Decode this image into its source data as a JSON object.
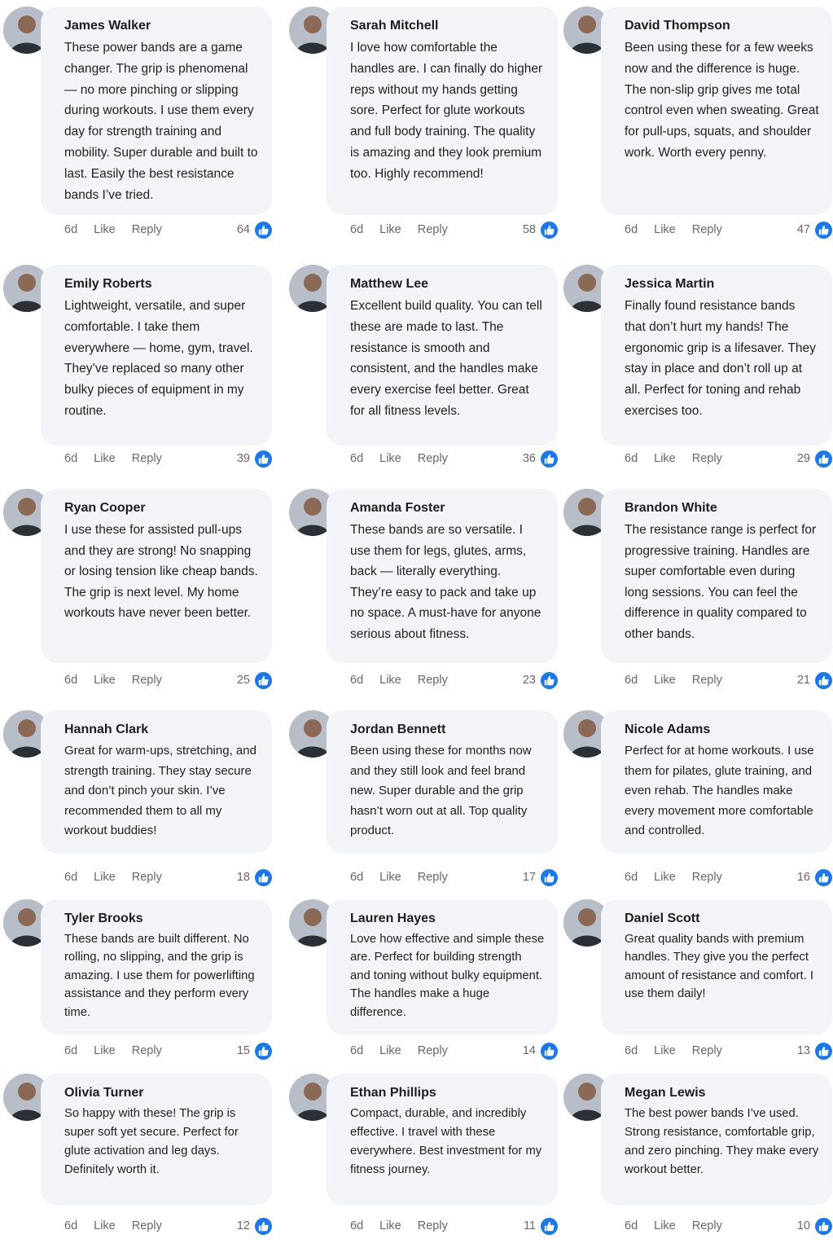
{
  "comments": [
    {
      "name": "James Walker",
      "text": "These power bands are a game changer. The grip is phenomenal — no more pinching or slipping during workouts. I use them every day for strength training and mobility. Super durable and built to last. Easily the best resistance bands I’ve tried.",
      "time": "6d",
      "like": "Like",
      "reply": "Reply",
      "count": "64"
    },
    {
      "name": "Sarah Mitchell",
      "text": "I love how comfortable the handles are. I can finally do higher reps without my hands getting sore. Perfect for glute workouts and full body training. The quality is amazing and they look premium too. Highly recommend!",
      "time": "6d",
      "like": "Like",
      "reply": "Reply",
      "count": "58"
    },
    {
      "name": "David Thompson",
      "text": "Been using these for a few weeks now and the difference is huge. The non-slip grip gives me total control even when sweating. Great for pull-ups, squats, and shoulder work. Worth every penny.",
      "time": "6d",
      "like": "Like",
      "reply": "Reply",
      "count": "47"
    },
    {
      "name": "Emily Roberts",
      "text": "Lightweight, versatile, and super comfortable. I take them everywhere — home, gym, travel. They’ve replaced so many other bulky pieces of equipment in my routine.",
      "time": "6d",
      "like": "Like",
      "reply": "Reply",
      "count": "39"
    },
    {
      "name": "Matthew Lee",
      "text": "Excellent build quality. You can tell these are made to last. The resistance is smooth and consistent, and the handles make every exercise feel better. Great for all fitness levels.",
      "time": "6d",
      "like": "Like",
      "reply": "Reply",
      "count": "36"
    },
    {
      "name": "Jessica Martin",
      "text": "Finally found resistance bands that don’t hurt my hands! The ergonomic grip is a lifesaver. They stay in place and don’t roll up at all. Perfect for toning and rehab exercises too.",
      "time": "6d",
      "like": "Like",
      "reply": "Reply",
      "count": "29"
    },
    {
      "name": "Ryan Cooper",
      "text": "I use these for assisted pull-ups and they are strong! No snapping or losing tension like cheap bands. The grip is next level. My home workouts have never been better.",
      "time": "6d",
      "like": "Like",
      "reply": "Reply",
      "count": "25"
    },
    {
      "name": "Amanda Foster",
      "text": "These bands are so versatile. I use them for legs, glutes, arms, back — literally everything. They’re easy to pack and take up no space. A must-have for anyone serious about fitness.",
      "time": "6d",
      "like": "Like",
      "reply": "Reply",
      "count": "23"
    },
    {
      "name": "Brandon White",
      "text": "The resistance range is perfect for progressive training. Handles are super comfortable even during long sessions. You can feel the difference in quality compared to other bands.",
      "time": "6d",
      "like": "Like",
      "reply": "Reply",
      "count": "21"
    },
    {
      "name": "Hannah Clark",
      "text": "Great for warm-ups, stretching, and strength training. They stay secure and don’t pinch your skin. I’ve recommended them to all my workout buddies!",
      "time": "6d",
      "like": "Like",
      "reply": "Reply",
      "count": "18"
    },
    {
      "name": "Jordan Bennett",
      "text": "Been using these for months now and they still look and feel brand new. Super durable and the grip hasn’t worn out at all. Top quality product.",
      "time": "6d",
      "like": "Like",
      "reply": "Reply",
      "count": "17"
    },
    {
      "name": "Nicole Adams",
      "text": "Perfect for at home workouts. I use them for pilates, glute training, and even rehab. The handles make every movement more comfortable and controlled.",
      "time": "6d",
      "like": "Like",
      "reply": "Reply",
      "count": "16"
    },
    {
      "name": "Tyler Brooks",
      "text": "These bands are built different. No rolling, no slipping, and the grip is amazing. I use them for powerlifting assistance and they perform every time.",
      "time": "6d",
      "like": "Like",
      "reply": "Reply",
      "count": "15"
    },
    {
      "name": "Lauren Hayes",
      "text": "Love how effective and simple these are. Perfect for building strength and toning without bulky equipment. The handles make a huge difference.",
      "time": "6d",
      "like": "Like",
      "reply": "Reply",
      "count": "14"
    },
    {
      "name": "Daniel Scott",
      "text": "Great quality bands with premium handles. They give you the perfect amount of resistance and comfort. I use them daily!",
      "time": "6d",
      "like": "Like",
      "reply": "Reply",
      "count": "13"
    },
    {
      "name": "Olivia Turner",
      "text": "So happy with these! The grip is super soft yet secure. Perfect for glute activation and leg days. Definitely worth it.",
      "time": "6d",
      "like": "Like",
      "reply": "Reply",
      "count": "12"
    },
    {
      "name": "Ethan Phillips",
      "text": "Compact, durable, and incredibly effective. I travel with these everywhere. Best investment for my fitness journey.",
      "time": "6d",
      "like": "Like",
      "reply": "Reply",
      "count": "11"
    },
    {
      "name": "Megan Lewis",
      "text": "The best power bands I’ve used. Strong resistance, comfortable grip, and zero pinching. They make every workout better.",
      "time": "6d",
      "like": "Like",
      "reply": "Reply",
      "count": "10"
    }
  ],
  "icons": {
    "like": "thumbs-up-icon",
    "avatar": "user-avatar"
  },
  "colors": {
    "like_badge": "#1877f2",
    "bubble": "#f3f4f7",
    "meta": "#65676b"
  }
}
